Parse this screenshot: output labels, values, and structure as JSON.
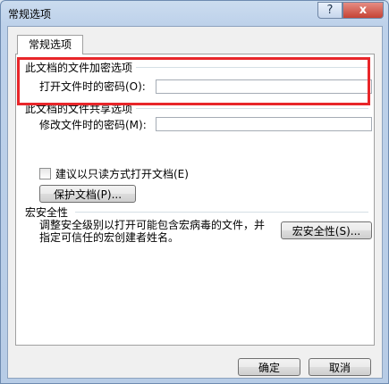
{
  "window": {
    "title": "常规选项",
    "help_label": "?",
    "close_label": "x"
  },
  "tab": {
    "label": "常规选项"
  },
  "encryption": {
    "section_title": "此文档的文件加密选项",
    "open_password_label": "打开文件时的密码(O):",
    "open_password_value": ""
  },
  "sharing": {
    "section_title": "此文档的文件共享选项",
    "modify_password_label": "修改文件时的密码(M):",
    "modify_password_value": "",
    "readonly_label": "建议以只读方式打开文档(E)",
    "readonly_checked": false,
    "protect_button": "保护文档(P)..."
  },
  "macro": {
    "section_title": "宏安全性",
    "description": "调整安全级别以打开可能包含宏病毒的文件，并指定可信任的宏创建者姓名。",
    "button": "宏安全性(S)..."
  },
  "footer": {
    "ok": "确定",
    "cancel": "取消"
  },
  "colors": {
    "highlight_border": "#e8262a",
    "title_bar": "#cbdcef",
    "close_button": "#c64334"
  }
}
